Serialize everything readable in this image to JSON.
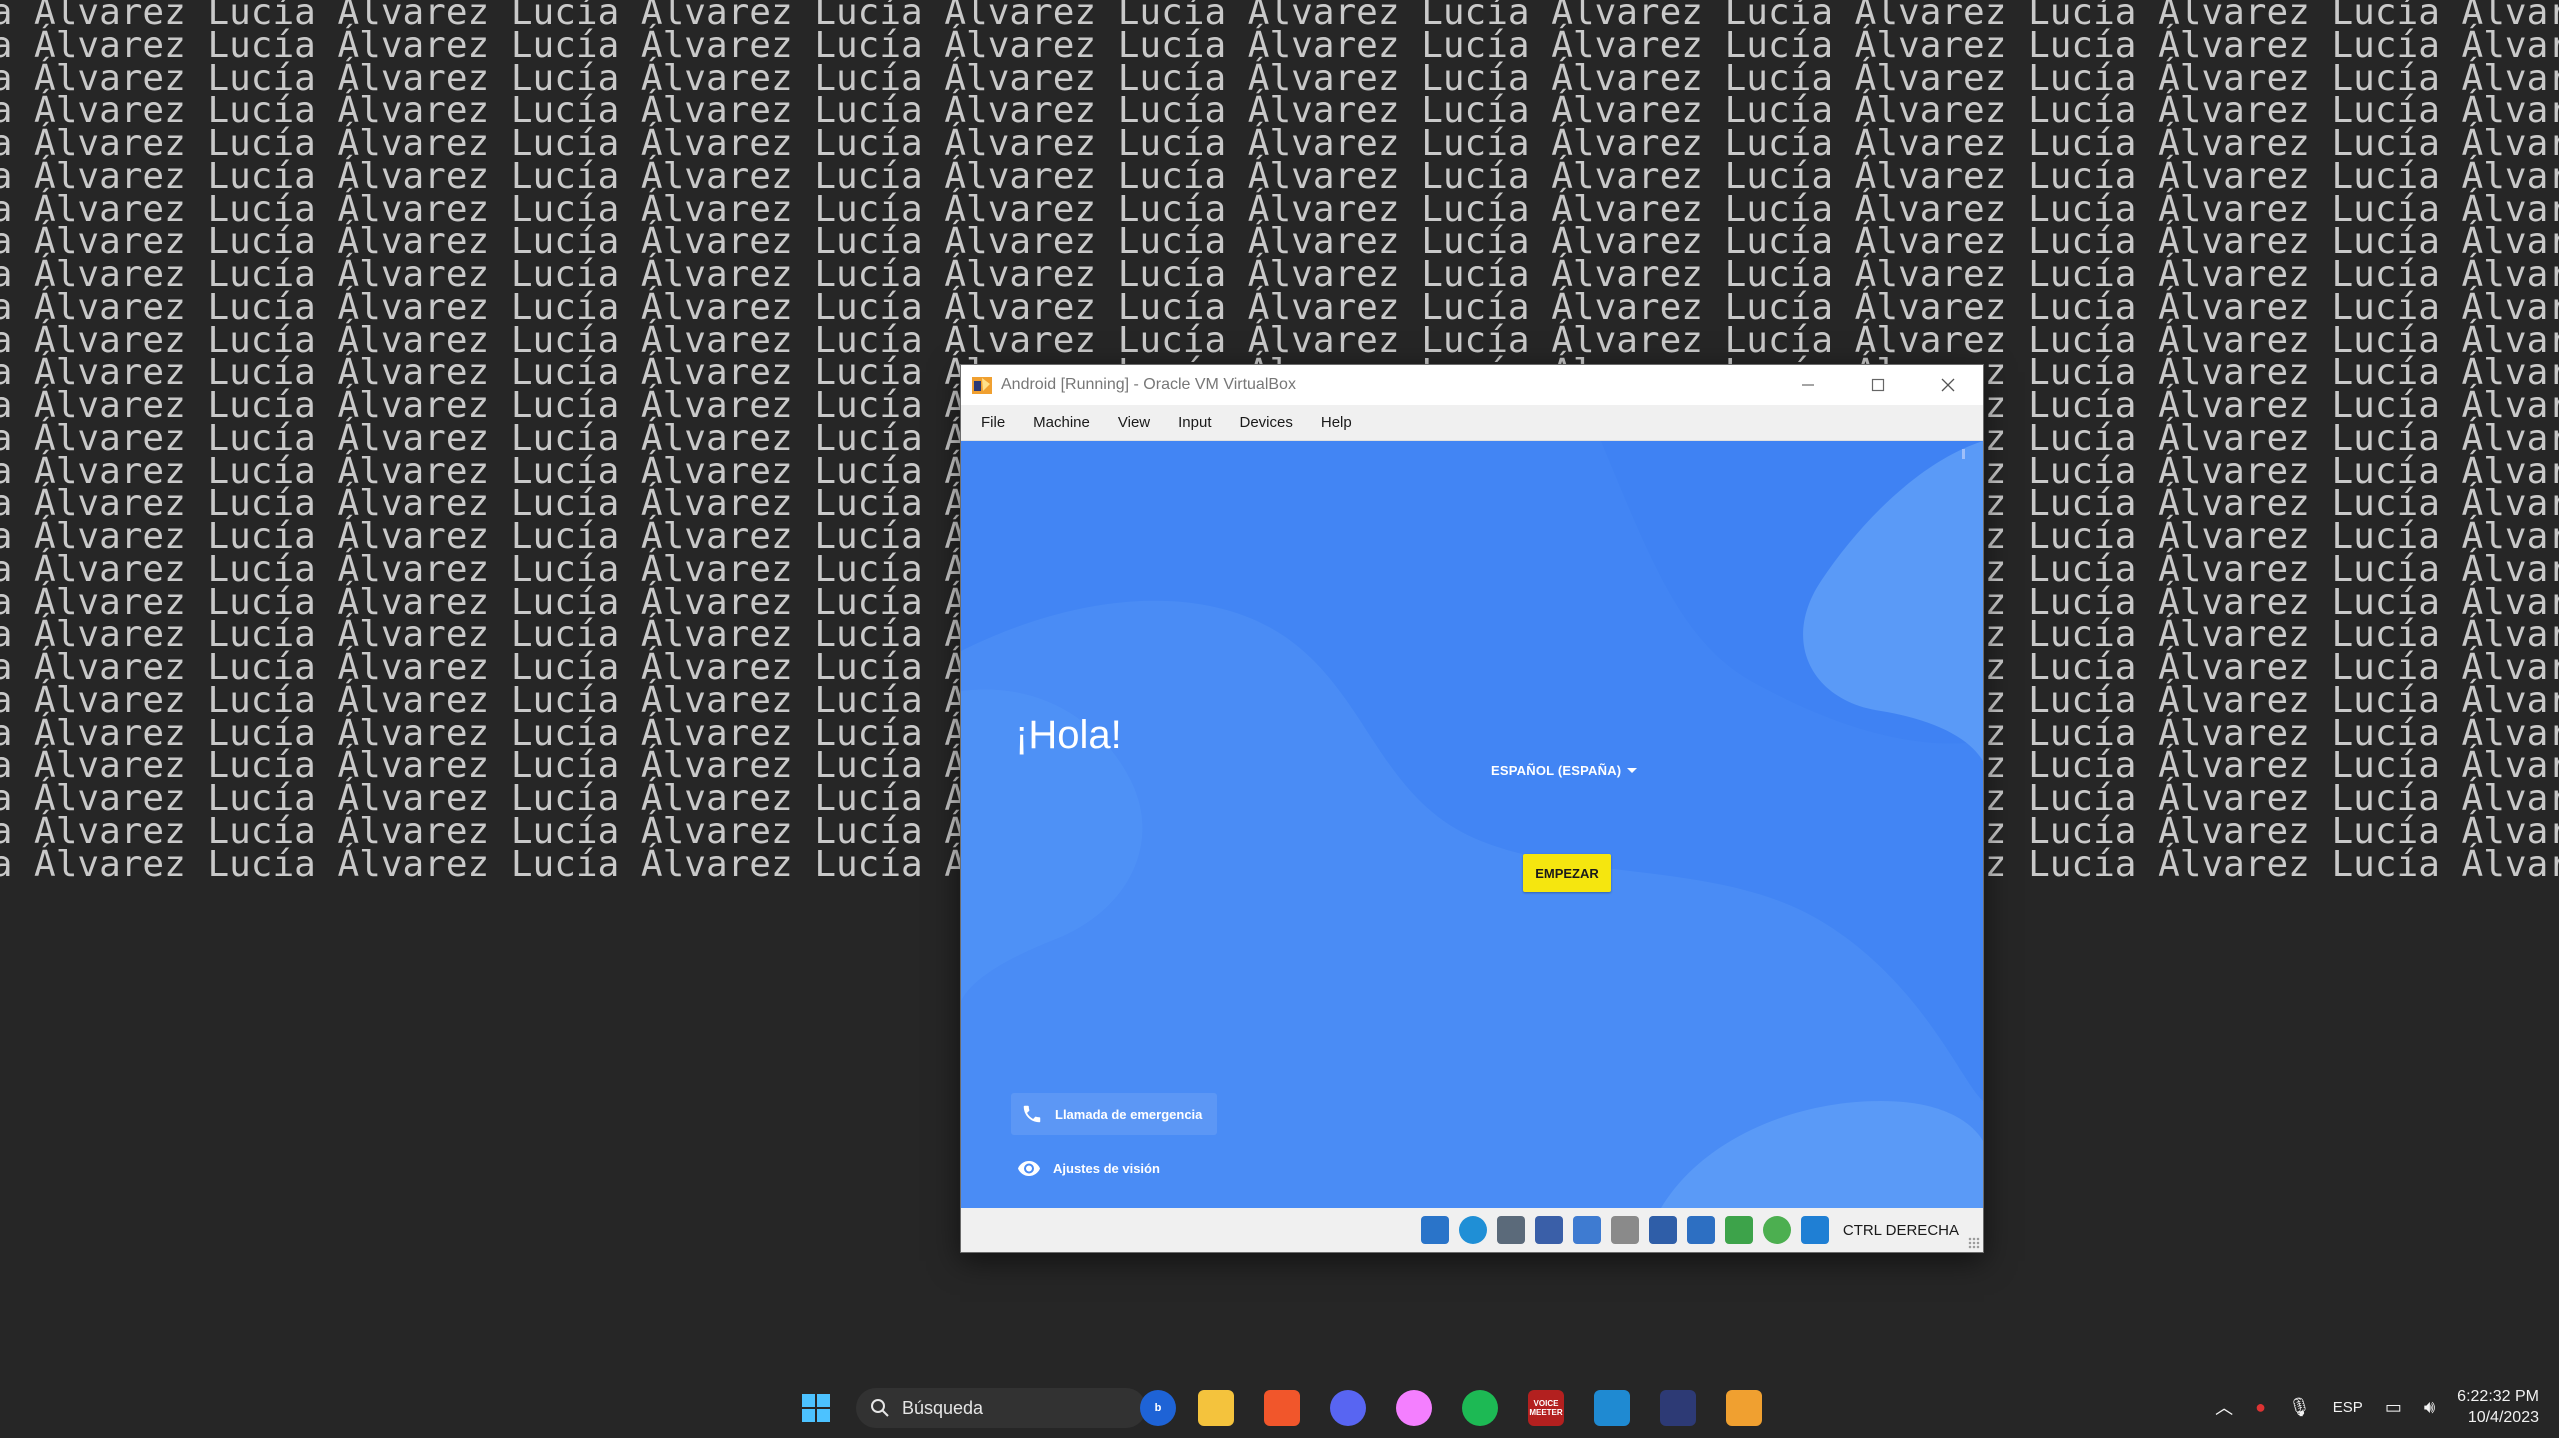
{
  "wallpaper": {
    "first_name": "Lucía",
    "last_name": "Álvarez",
    "text_color": "#c9c9c9",
    "background_color": "#262626"
  },
  "window": {
    "title": "Android [Running] - Oracle VM VirtualBox",
    "controls": [
      "minimize-icon",
      "maximize-icon",
      "close-icon"
    ]
  },
  "menu": {
    "items": [
      "File",
      "Machine",
      "View",
      "Input",
      "Devices",
      "Help"
    ]
  },
  "android": {
    "greeting": "¡Hola!",
    "language": "ESPAÑOL (ESPAÑA)",
    "start_button": "EMPEZAR",
    "emergency_call": "Llamada de emergencia",
    "vision_settings": "Ajustes de visión",
    "background_color": "#4285f4",
    "button_color": "#f5e60f"
  },
  "statusbar": {
    "icons": [
      "hard-disk-icon",
      "optical-drive-icon",
      "audio-icon",
      "network-icon",
      "usb-icon",
      "shared-folders-icon",
      "display-icon",
      "video-capture-icon",
      "recording-icon",
      "cpu-execution-icon",
      "mouse-integration-icon"
    ],
    "host_key": "CTRL DERECHA"
  },
  "taskbar": {
    "search_placeholder": "Búsqueda",
    "apps": [
      "windows-start-icon",
      "bing-icon",
      "file-explorer-icon",
      "brave-icon",
      "discord-icon",
      "discord-pink-icon",
      "spotify-icon",
      "voicemeeter-icon",
      "vscode-icon",
      "virtualbox-icon",
      "virtualbox-vm-icon"
    ],
    "voicemeeter_label": "VOICE MEETER",
    "tray": {
      "language": "ESP",
      "time": "6:22:32 PM",
      "date": "10/4/2023"
    }
  }
}
